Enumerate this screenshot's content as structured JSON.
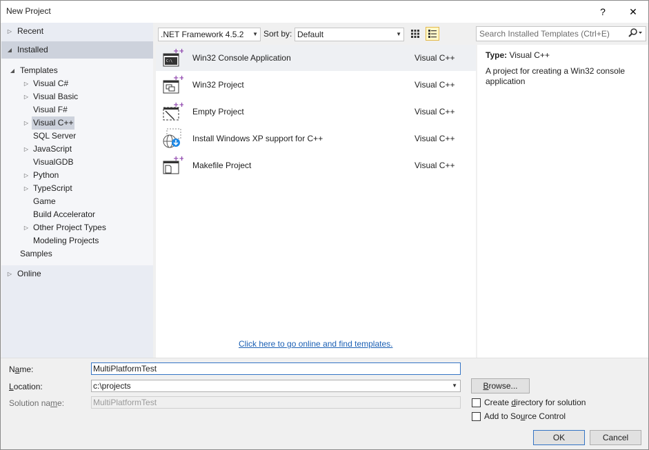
{
  "window": {
    "title": "New Project",
    "help_glyph": "?",
    "close_glyph": "✕"
  },
  "tree": {
    "recent": "Recent",
    "installed": "Installed",
    "templates": "Templates",
    "items": [
      {
        "label": "Visual C#",
        "expandable": true
      },
      {
        "label": "Visual Basic",
        "expandable": true
      },
      {
        "label": "Visual F#",
        "expandable": false
      },
      {
        "label": "Visual C++",
        "expandable": true,
        "selected": true
      },
      {
        "label": "SQL Server",
        "expandable": false
      },
      {
        "label": "JavaScript",
        "expandable": true
      },
      {
        "label": "VisualGDB",
        "expandable": false
      },
      {
        "label": "Python",
        "expandable": true
      },
      {
        "label": "TypeScript",
        "expandable": true
      },
      {
        "label": "Game",
        "expandable": false
      },
      {
        "label": "Build Accelerator",
        "expandable": false
      },
      {
        "label": "Other Project Types",
        "expandable": true
      },
      {
        "label": "Modeling Projects",
        "expandable": false
      }
    ],
    "samples": "Samples",
    "online": "Online"
  },
  "toolbar": {
    "framework": ".NET Framework 4.5.2",
    "sort_label": "Sort by:",
    "sort_value": "Default",
    "search_placeholder": "Search Installed Templates (Ctrl+E)"
  },
  "templates": [
    {
      "name": "Win32 Console Application",
      "lang": "Visual C++",
      "icon": "console-app-icon",
      "selected": true
    },
    {
      "name": "Win32 Project",
      "lang": "Visual C++",
      "icon": "win32-project-icon"
    },
    {
      "name": "Empty Project",
      "lang": "Visual C++",
      "icon": "empty-project-icon"
    },
    {
      "name": "Install Windows XP support for C++",
      "lang": "Visual C++",
      "icon": "globe-download-icon"
    },
    {
      "name": "Makefile Project",
      "lang": "Visual C++",
      "icon": "makefile-project-icon"
    }
  ],
  "online_link": "Click here to go online and find templates.",
  "details": {
    "type_label": "Type:",
    "type_value": "Visual C++",
    "description": "A project for creating a Win32 console application"
  },
  "form": {
    "name_label_pre": "N",
    "name_label_ul": "a",
    "name_label_post": "me:",
    "name_value": "MultiPlatformTest",
    "location_label_pre": "",
    "location_label_ul": "L",
    "location_label_post": "ocation:",
    "location_value": "c:\\projects",
    "solution_label_pre": "Solution na",
    "solution_label_ul": "m",
    "solution_label_post": "e:",
    "solution_value": "MultiPlatformTest",
    "browse_pre": "",
    "browse_ul": "B",
    "browse_post": "rowse...",
    "create_dir_pre": "Create ",
    "create_dir_ul": "d",
    "create_dir_post": "irectory for solution",
    "source_ctrl_pre": "Add to So",
    "source_ctrl_ul": "u",
    "source_ctrl_post": "rce Control",
    "ok": "OK",
    "cancel": "Cancel"
  }
}
